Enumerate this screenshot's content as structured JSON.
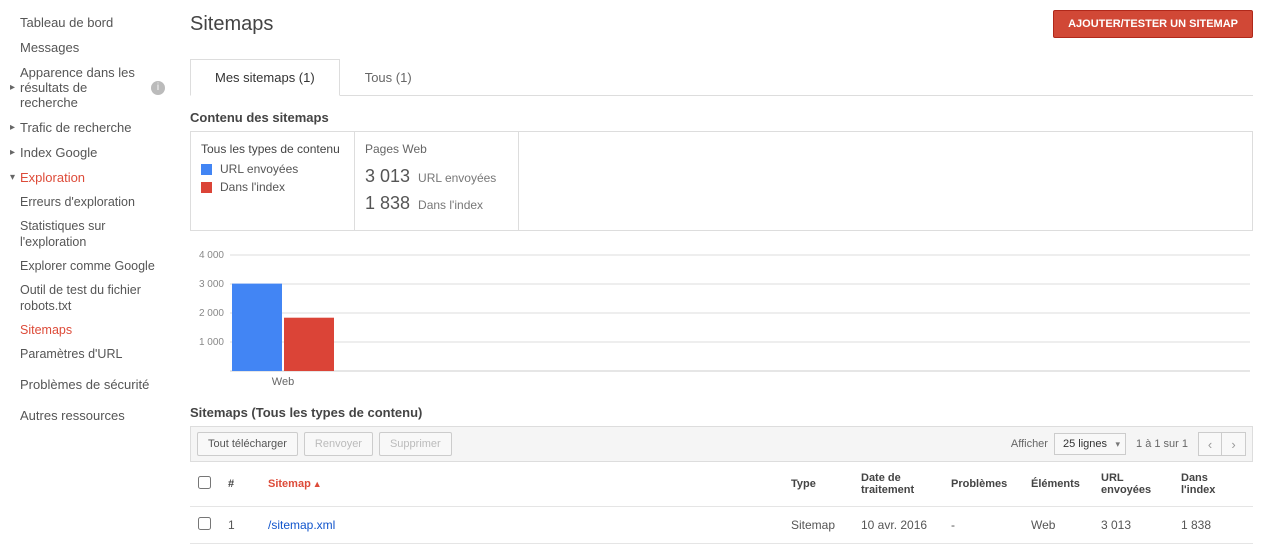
{
  "sidebar": {
    "items": [
      {
        "label": "Tableau de bord",
        "caret": false
      },
      {
        "label": "Messages",
        "caret": false
      },
      {
        "label": "Apparence dans les résultats de recherche",
        "caret": true,
        "info": true
      },
      {
        "label": "Trafic de recherche",
        "caret": true
      },
      {
        "label": "Index Google",
        "caret": true
      },
      {
        "label": "Exploration",
        "caret": true,
        "open": true,
        "children": [
          "Erreurs d'exploration",
          "Statistiques sur l'exploration",
          "Explorer comme Google",
          "Outil de test du fichier robots.txt",
          "Sitemaps",
          "Paramètres d'URL"
        ],
        "active_child_index": 4
      },
      {
        "label": "Problèmes de sécurité",
        "caret": false
      },
      {
        "label": "Autres ressources",
        "caret": false
      }
    ]
  },
  "header": {
    "title": "Sitemaps",
    "add_button": "AJOUTER/TESTER UN SITEMAP"
  },
  "tabs": [
    {
      "label": "Mes sitemaps (1)",
      "active": true
    },
    {
      "label": "Tous (1)",
      "active": false
    }
  ],
  "summary": {
    "section_title": "Contenu des sitemaps",
    "legend_title": "Tous les types de contenu",
    "legend": [
      {
        "label": "URL envoyées",
        "color": "#4285f4"
      },
      {
        "label": "Dans l'index",
        "color": "#db4437"
      }
    ],
    "stats_title": "Pages Web",
    "stats": [
      {
        "value": "3 013",
        "label": "URL envoyées"
      },
      {
        "value": "1 838",
        "label": "Dans l'index"
      }
    ]
  },
  "chart_data": {
    "type": "bar",
    "categories": [
      "Web"
    ],
    "series": [
      {
        "name": "URL envoyées",
        "values": [
          3013
        ],
        "color": "#4285f4"
      },
      {
        "name": "Dans l'index",
        "values": [
          1838
        ],
        "color": "#db4437"
      }
    ],
    "ylim": [
      0,
      4000
    ],
    "yticks": [
      1000,
      2000,
      3000,
      4000
    ],
    "xlabel": "",
    "ylabel": ""
  },
  "table_section": {
    "title": "Sitemaps (Tous les types de contenu)",
    "actions": {
      "download_all": "Tout télécharger",
      "resend": "Renvoyer",
      "delete": "Supprimer"
    },
    "pager": {
      "show_label": "Afficher",
      "page_size": "25 lignes",
      "range": "1 à 1 sur 1"
    },
    "columns": {
      "num": "#",
      "sitemap": "Sitemap",
      "type": "Type",
      "date": "Date de traitement",
      "problems": "Problèmes",
      "elements": "Éléments",
      "sent": "URL envoyées",
      "index": "Dans l'index"
    },
    "rows": [
      {
        "num": "1",
        "sitemap": "/sitemap.xml",
        "type": "Sitemap",
        "date": "10 avr. 2016",
        "problems": "-",
        "elements": "Web",
        "sent": "3 013",
        "index": "1 838"
      }
    ]
  }
}
